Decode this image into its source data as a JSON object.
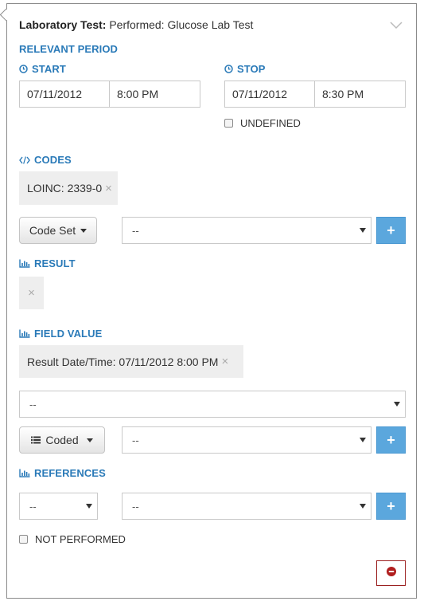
{
  "header": {
    "title_bold": "Laboratory Test:",
    "title_rest": " Performed: Glucose Lab Test"
  },
  "relevant_period": {
    "heading": "RELEVANT PERIOD",
    "start": {
      "label": "START",
      "date": "07/11/2012",
      "time": "8:00 PM"
    },
    "stop": {
      "label": "STOP",
      "date": "07/11/2012",
      "time": "8:30 PM"
    },
    "undefined_label": "UNDEFINED"
  },
  "codes": {
    "heading": "CODES",
    "tags": [
      "LOINC: 2339-0"
    ],
    "code_set_label": "Code Set",
    "code_select_value": "--"
  },
  "result": {
    "heading": "RESULT"
  },
  "field_value": {
    "heading": "FIELD VALUE",
    "tags": [
      "Result Date/Time: 07/11/2012 8:00 PM"
    ],
    "field_select_value": "--",
    "coded_label": "Coded",
    "coded_select_value": "--"
  },
  "references": {
    "heading": "REFERENCES",
    "type_select_value": "--",
    "target_select_value": "--"
  },
  "not_performed_label": "NOT PERFORMED",
  "colors": {
    "accent": "#2a7ab8",
    "plus_button": "#5ba7dd",
    "delete_border": "#9b2020",
    "delete_icon": "#b01e1e"
  },
  "icons": {
    "collapse": "chevron-down-icon",
    "clock": "clock-icon",
    "code": "code-icon",
    "chart": "bar-chart-icon",
    "list": "list-icon",
    "add": "plus-icon",
    "remove": "close-icon",
    "delete": "minus-circle-icon"
  }
}
